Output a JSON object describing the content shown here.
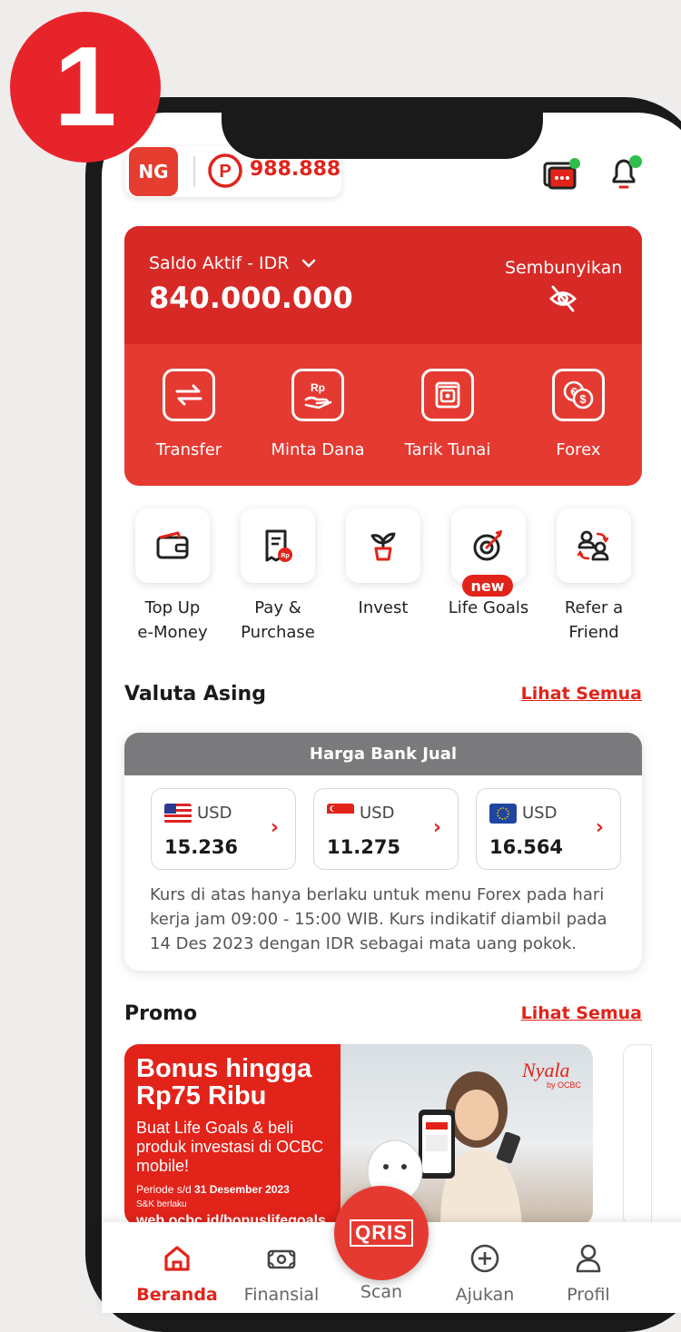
{
  "step_number": "1",
  "header": {
    "avatar_initials": "NG",
    "points": "988.888"
  },
  "balance": {
    "label": "Saldo Aktif - IDR",
    "amount": "840.000.000",
    "hide_label": "Sembunyikan"
  },
  "quick_actions": [
    {
      "label": "Transfer",
      "icon": "transfer-icon"
    },
    {
      "label": "Minta Dana",
      "icon": "request-money-icon"
    },
    {
      "label": "Tarik Tunai",
      "icon": "cash-withdraw-icon"
    },
    {
      "label": "Forex",
      "icon": "forex-icon"
    }
  ],
  "shortcuts": [
    {
      "line1": "Top Up",
      "line2": "e-Money",
      "icon": "wallet-icon"
    },
    {
      "line1": "Pay &",
      "line2": "Purchase",
      "icon": "bill-icon"
    },
    {
      "line1": "Invest",
      "line2": "",
      "icon": "plant-icon"
    },
    {
      "line1": "Life Goals",
      "line2": "",
      "icon": "target-icon",
      "badge": "new"
    },
    {
      "line1": "Refer a",
      "line2": "Friend",
      "icon": "refer-icon"
    }
  ],
  "forex": {
    "title": "Valuta Asing",
    "see_all": "Lihat Semua",
    "header": "Harga Bank Jual",
    "items": [
      {
        "flag": "us-flag-icon",
        "currency": "USD",
        "rate": "15.236"
      },
      {
        "flag": "sg-flag-icon",
        "currency": "USD",
        "rate": "11.275"
      },
      {
        "flag": "eu-flag-icon",
        "currency": "USD",
        "rate": "16.564"
      }
    ],
    "note": "Kurs di atas hanya berlaku untuk menu Forex pada hari kerja jam 09:00 - 15:00 WIB. Kurs indikatif diambil pada 14 Des 2023 dengan IDR sebagai mata uang pokok."
  },
  "promo": {
    "title": "Promo",
    "see_all": "Lihat Semua",
    "banner_title_1": "Bonus hingga",
    "banner_title_2": "Rp75 Ribu",
    "banner_sub": "Buat Life Goals & beli produk investasi di OCBC mobile!",
    "banner_period_prefix": "Periode s/d ",
    "banner_period_date": "31 Desember 2023",
    "banner_snk": "S&K berlaku",
    "banner_url": "web.ocbc.id/bonuslifegoals",
    "brand": "Nyala",
    "brand_sub": "by OCBC"
  },
  "bottom_nav": [
    {
      "label": "Beranda",
      "icon": "home-icon",
      "active": true
    },
    {
      "label": "Finansial",
      "icon": "money-icon"
    },
    {
      "label": "Scan",
      "icon": "qris-icon"
    },
    {
      "label": "Ajukan",
      "icon": "plus-circle-icon"
    },
    {
      "label": "Profil",
      "icon": "profile-icon"
    }
  ],
  "qris_label": "QRIS",
  "colors": {
    "primary_red": "#E2231A",
    "card_red": "#E53A32",
    "grey_header": "#7A7A7C"
  }
}
